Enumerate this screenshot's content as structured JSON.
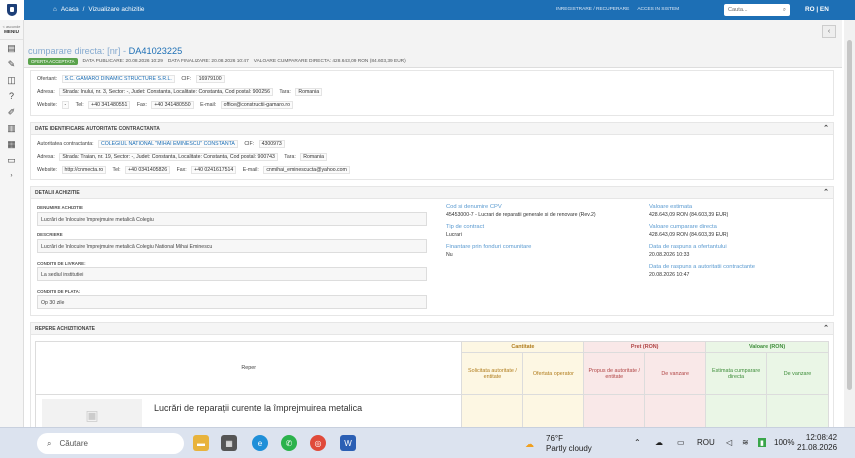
{
  "topbar": {
    "breadcrumb_home": "Acasa",
    "breadcrumb_sep": "/",
    "breadcrumb_current": "Vizualizare achizitie",
    "link_register": "INREGISTRARE / RECUPERARE",
    "link_login": "ACCES IN SISTEM",
    "search_placeholder": "Cauta...",
    "lang": "RO | EN"
  },
  "sidebar": {
    "menu_top": "< ascunde",
    "menu_label": "MENIU"
  },
  "header": {
    "title_prefix": "cumparare directa: [nr] - ",
    "title_code": "DA41023225",
    "status_badge": "OFERTA ACCEPTATA",
    "published": "DATA PUBLICARE: 20.08.2026 10:29",
    "finalized": "DATA FINALIZARE: 20.08.2026 10:47",
    "value": "VALOARE CUMPARARE DIRECTA: 428.643,09 RON (84.603,39 EUR)"
  },
  "offerer": {
    "label_ofertant": "Ofertant:",
    "name": "S.C. GAMARO DINAMIC STRUCTURE S.R.L.",
    "label_cif": "CIF:",
    "cif": "16979100",
    "label_adresa": "Adresa:",
    "address": "Strada: Inului, nr. 3, Sector: -, Judet: Constanta, Localitate: Constanta, Cod postal: 900256",
    "label_tara": "Tara:",
    "country": "Romania",
    "label_website": "Website:",
    "website": "-",
    "label_tel": "Tel:",
    "tel": "+40 341480551",
    "label_fax": "Fax:",
    "fax": "+40 341480550",
    "label_email": "E-mail:",
    "email": "office@constructii-gamaro.ro"
  },
  "authority": {
    "section_title": "DATE IDENTIFICARE AUTORITATE CONTRACTANTA",
    "label_autoritate": "Autoritatea contractanta:",
    "name": "COLEGIUL NATIONAL \"MIHAI EMINESCU\" CONSTANTA",
    "label_cif": "CIF:",
    "cif": "4300973",
    "label_adresa": "Adresa:",
    "address": "Strada: Traian, nr. 19, Sector: -, Judet: Constanta, Localitate: Constanta, Cod postal: 900743",
    "label_tara": "Tara:",
    "country": "Romania",
    "label_website": "Website:",
    "website": "http://cnmecta.ro",
    "label_tel": "Tel:",
    "tel": "+40 0341405826",
    "label_fax": "Fax:",
    "fax": "+40 0241617514",
    "label_email": "E-mail:",
    "email": "cnmihai_eminescucta@yahoo.com"
  },
  "details": {
    "section_title": "DETALII ACHIZITIE",
    "denumire_label": "DENUMIRE ACHIZITIE",
    "denumire": "Lucrări de înlocuire împrejmuire metalică Colegiu",
    "descriere_label": "DESCRIERE",
    "descriere": "Lucrări de înlocuire împrejmuire metalică Colegiu National Mihai Eminescu",
    "livrare_label": "CONDITII DE LIVRARE:",
    "livrare": "La sediul institutiei",
    "plata_label": "CONDITII DE PLATA:",
    "plata": "Op 30 zile",
    "cpv_label": "Cod si denumire CPV",
    "cpv": "45453000-7 - Lucrari de reparatii generale si de renovare (Rev.2)",
    "tip_label": "Tip de contract",
    "tip": "Lucrari",
    "fonduri_label": "Finantare prin fonduri comunitare",
    "fonduri": "Nu",
    "val_est_label": "Valoare estimata",
    "val_est": "428.643,09  RON (84.603,39  EUR)",
    "val_cd_label": "Valoare cumparare directa",
    "val_cd": "428.643,09  RON (84.603,39  EUR)",
    "raspuns_of_label": "Data de raspuns a ofertantului",
    "raspuns_of": "20.08.2026 10:33",
    "raspuns_ac_label": "Data de raspuns a autoritatii contractante",
    "raspuns_ac": "20.08.2026 10:47"
  },
  "repere": {
    "section_title": "REPERE ACHIZITIONATE",
    "col_reper": "Reper",
    "grp_cantitate": "Cantitate",
    "grp_pret": "Pret (RON)",
    "grp_valoare": "Valoare (RON)",
    "sub_solicitata": "Solicitata autoritate / entitate",
    "sub_ofertata": "Ofertata operator",
    "sub_propus": "Propus de autoritate / entitate",
    "sub_vanzare": "De vanzare",
    "sub_estimata": "Estimata cumparare directa",
    "sub_vanzare2": "De vanzare",
    "item_name": "Lucrări de reparații curente la împrejmuirea metalica"
  },
  "taskbar": {
    "search": "Căutare",
    "temp": "76°F",
    "weather": "Partly cloudy",
    "lang": "ROU",
    "battery": "100%",
    "time": "12:08:42",
    "date": "21.08.2026"
  },
  "colors": {
    "brand": "#1d6fb5",
    "accepted": "#5aa34c"
  }
}
